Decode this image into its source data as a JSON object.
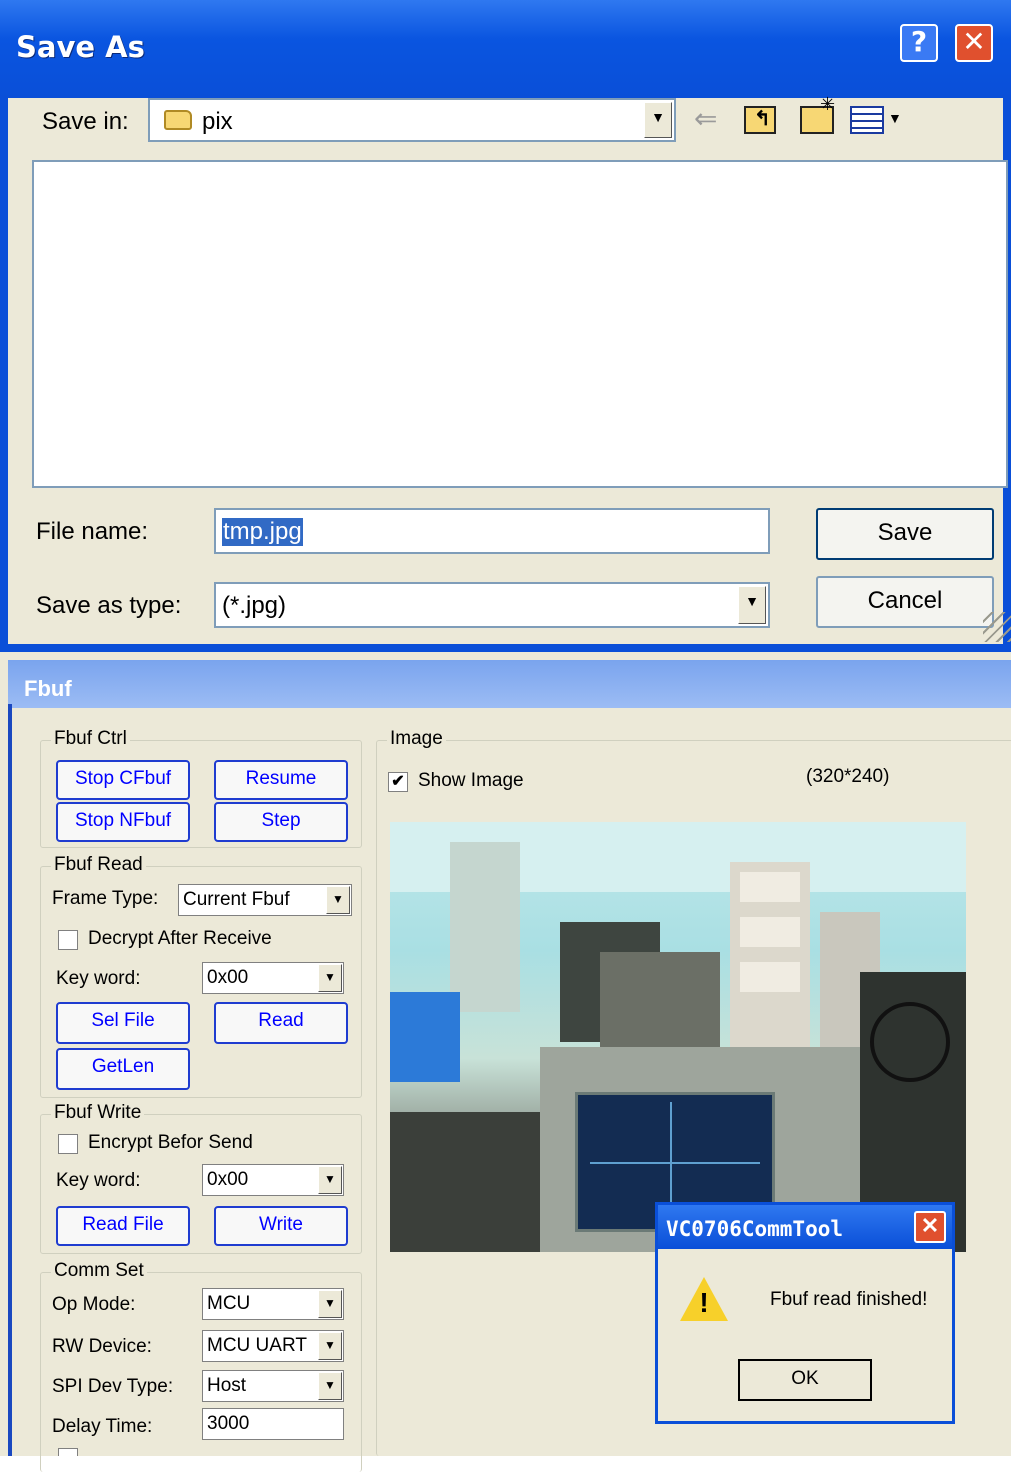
{
  "save_dialog": {
    "title": "Save As",
    "help_glyph": "?",
    "close_glyph": "✕",
    "save_in_label": "Save in:",
    "save_in_value": "pix",
    "file_name_label": "File name:",
    "file_name_value": "tmp.jpg",
    "save_as_type_label": "Save as type:",
    "save_as_type_value": "(*.jpg)",
    "save_button": "Save",
    "cancel_button": "Cancel",
    "icons": [
      "back-arrow-icon",
      "up-folder-icon",
      "new-folder-icon",
      "view-menu-icon"
    ]
  },
  "fbuf_window": {
    "title": "Fbuf",
    "fbuf_ctrl": {
      "title": "Fbuf Ctrl",
      "stop_cfbuf": "Stop CFbuf",
      "resume": "Resume",
      "stop_nfbuf": "Stop NFbuf",
      "step": "Step"
    },
    "fbuf_read": {
      "title": "Fbuf Read",
      "frame_type_label": "Frame Type:",
      "frame_type_value": "Current Fbuf",
      "decrypt_label": "Decrypt After Receive",
      "decrypt_checked": false,
      "key_word_label": "Key word:",
      "key_word_value": "0x00",
      "sel_file": "Sel File",
      "read": "Read",
      "getlen": "GetLen"
    },
    "fbuf_write": {
      "title": "Fbuf Write",
      "encrypt_label": "Encrypt Befor Send",
      "encrypt_checked": false,
      "key_word_label": "Key word:",
      "key_word_value": "0x00",
      "read_file": "Read File",
      "write": "Write"
    },
    "comm_set": {
      "title": "Comm Set",
      "op_mode_label": "Op Mode:",
      "op_mode_value": "MCU",
      "rw_device_label": "RW Device:",
      "rw_device_value": "MCU UART",
      "spi_dev_type_label": "SPI Dev Type:",
      "spi_dev_type_value": "Host",
      "delay_time_label": "Delay Time:",
      "delay_time_value": "3000"
    },
    "image": {
      "title": "Image",
      "show_image_label": "Show Image",
      "show_image_checked": true,
      "resolution": "(320*240)"
    }
  },
  "message_box": {
    "title": "VC0706CommTool",
    "close_glyph": "✕",
    "message": "Fbuf read finished!",
    "warning_glyph": "!",
    "ok_button": "OK"
  },
  "colors": {
    "xp_title_blue": "#0a4fd8",
    "dialog_face": "#ece9d8",
    "button_text_blue": "#0000ff",
    "selection_blue": "#316ac5"
  }
}
